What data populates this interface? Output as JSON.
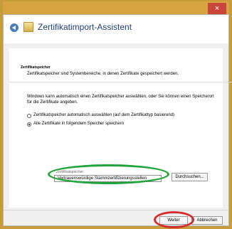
{
  "window": {
    "title": "Zertifikatimport-Assistent",
    "close_icon": "×"
  },
  "section": {
    "title": "Zertifikatspeicher",
    "description": "Zertifikatspeicher sind Systembereiche, in denen Zertifikate gespeichert werden."
  },
  "intro": "Windows kann automatisch einen Zertifikatspeicher auswählen, oder Sie können einen Speicherort für die Zertifikate angeben.",
  "options": {
    "auto_label": "Zertifikatspeicher automatisch auswählen (auf dem Zertifikattyp basierend)",
    "manual_label": "Alle Zertifikate in folgendem Speicher speichern",
    "selected": "manual"
  },
  "store": {
    "label": "Zertifikatspeicher:",
    "value": "Vertrauenswürdige Stammzertifizierungsstellen",
    "browse_label": "Durchsuchen..."
  },
  "buttons": {
    "next": "Weiter",
    "cancel": "Abbrechen"
  },
  "icons": {
    "back": "back-arrow-icon",
    "certificate": "certificate-icon"
  },
  "colors": {
    "highlight_green": "#22a33b",
    "highlight_red": "#d32d2d",
    "title_blue": "#1f3f78"
  }
}
